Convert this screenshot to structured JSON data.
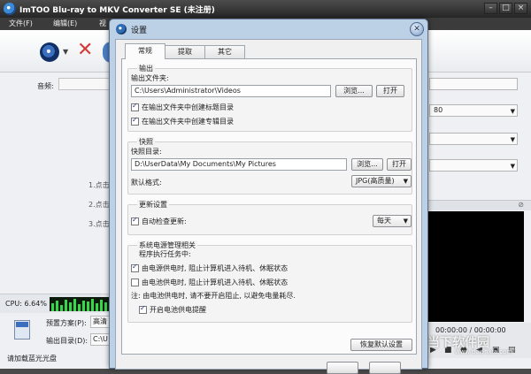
{
  "app": {
    "title": "ImTOO Blu-ray to MKV Converter SE (未注册)",
    "menu": [
      "文件(F)",
      "编辑(E)",
      "视"
    ],
    "left": {
      "audio_label": "音频:",
      "steps": [
        "1.点击",
        "2.点击",
        "3.点击"
      ],
      "cpu_label": "CPU: 6.64%",
      "preset_label": "预置方案(P):",
      "preset_value": "高清",
      "outdir_label": "输出目录(D):",
      "outdir_value": "C:\\U",
      "status": "请加载蓝光光盘"
    },
    "right": {
      "field_value": "80",
      "time": "00:00:00 / 00:00:00",
      "watermark": "当下软件园",
      "watermark_sub": "www.downxia.com"
    }
  },
  "dialog": {
    "title": "设置",
    "tabs": [
      "常规",
      "提取",
      "其它"
    ],
    "output": {
      "legend": "输出",
      "folder_label": "输出文件夹:",
      "folder_value": "C:\\Users\\Administrator\\Videos",
      "browse": "浏览...",
      "open": "打开",
      "check1": "在输出文件夹中创建标题目录",
      "check2": "在输出文件夹中创建专辑目录"
    },
    "snapshot": {
      "legend": "快照",
      "dir_label": "快照目录:",
      "dir_value": "D:\\UserData\\My Documents\\My Pictures",
      "browse": "浏览...",
      "open": "打开",
      "format_label": "默认格式:",
      "format_value": "JPG(高质量)"
    },
    "update": {
      "legend": "更新设置",
      "auto_check": "自动检查更新:",
      "interval": "每天"
    },
    "power": {
      "legend": "系统电源管理相关",
      "subtitle": "程序执行任务中:",
      "check_ac": "由电源供电时, 阻止计算机进入待机、休眠状态",
      "check_battery": "由电池供电时, 阻止计算机进入待机、休眠状态",
      "note": "注: 由电池供电时, 请不要开启阻止, 以避免电量耗尽.",
      "check_remind": "开启电池供电提醒"
    },
    "restore_defaults": "恢复默认设置"
  }
}
